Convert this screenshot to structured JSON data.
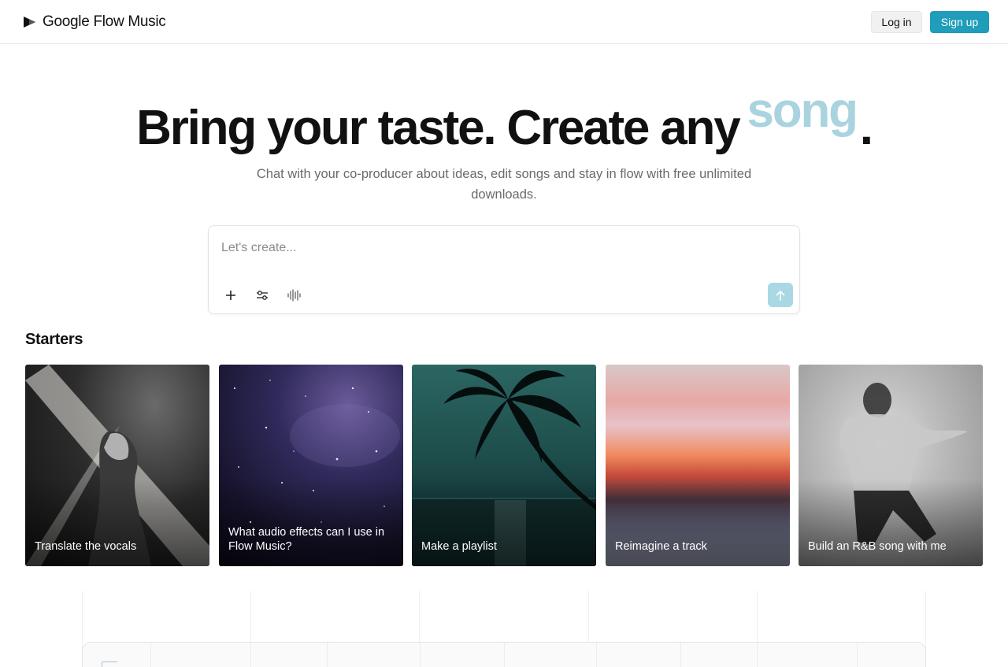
{
  "header": {
    "brand_name": "Google Flow Music",
    "login_label": "Log in",
    "signup_label": "Sign up"
  },
  "hero": {
    "title_main": "Bring your taste. Create any",
    "title_accent": "song",
    "title_end": ".",
    "subtitle": "Chat with your co-producer about ideas, edit songs and stay in flow with free unlimited downloads."
  },
  "prompt": {
    "placeholder": "Let's create...",
    "tools": [
      "plus-icon",
      "sliders-icon",
      "waveform-icon"
    ],
    "send_icon": "arrow-up-icon"
  },
  "starters": {
    "title": "Starters",
    "cards": [
      {
        "label": "Translate the vocals"
      },
      {
        "label": "What audio effects can I use in Flow Music?"
      },
      {
        "label": "Make a playlist"
      },
      {
        "label": "Reimagine a track"
      },
      {
        "label": "Build an R&B song with me"
      }
    ]
  },
  "colors": {
    "accent": "#1f9dba",
    "accent_light": "#a9d4df",
    "send_button": "#a9d8e4"
  }
}
